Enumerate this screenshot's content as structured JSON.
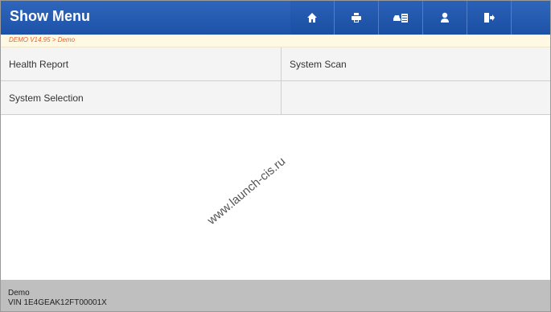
{
  "header": {
    "title": "Show Menu",
    "icons": [
      "home-icon",
      "print-icon",
      "vehicle-info-icon",
      "user-icon",
      "exit-icon"
    ]
  },
  "breadcrumb": "DEMO V14.95 > Demo",
  "menu": {
    "items": [
      "Health Report",
      "System Scan",
      "System Selection",
      ""
    ]
  },
  "watermark": "www.launch-cis.ru",
  "footer": {
    "line1": "Demo",
    "line2": "VIN 1E4GEAK12FT00001X"
  },
  "colors": {
    "header": "#2a60b6",
    "breadcrumb_text": "#e8622b",
    "footer": "#bfbfbf"
  }
}
